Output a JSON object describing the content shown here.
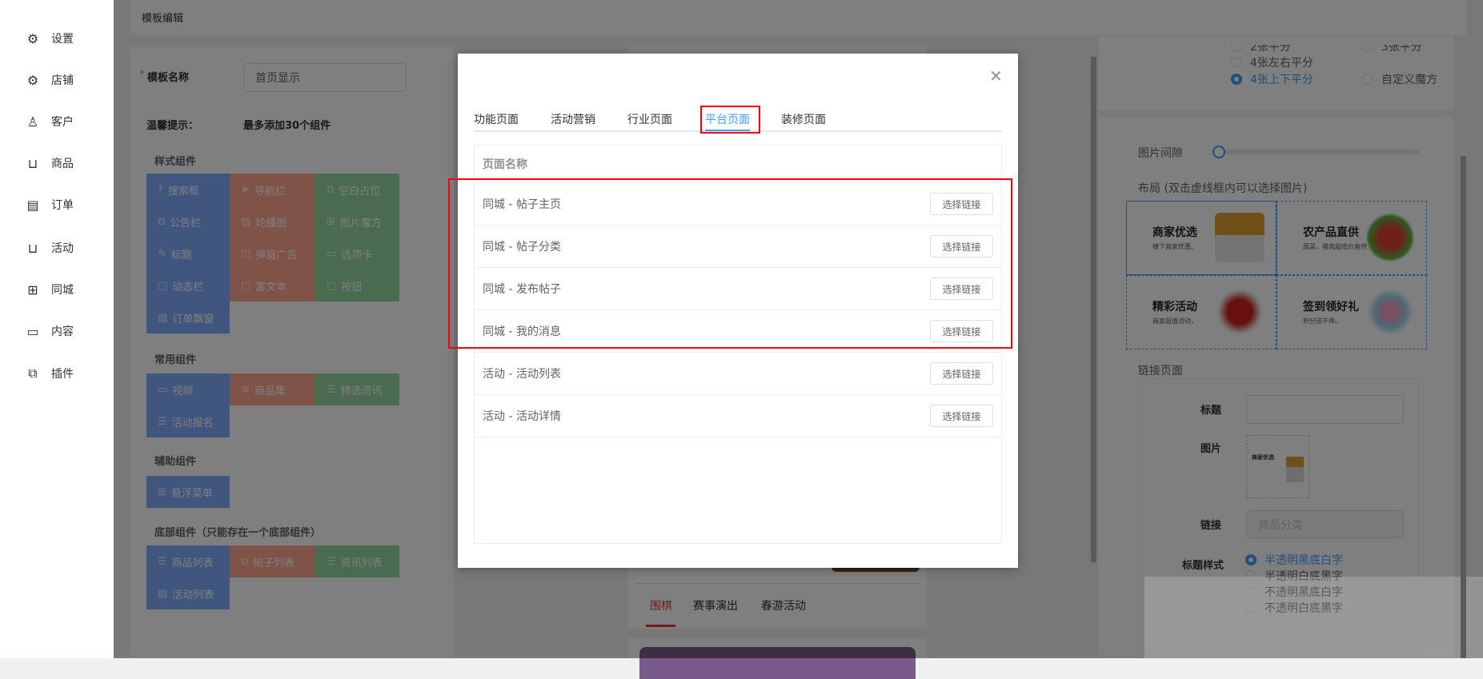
{
  "sidebar": {
    "items": [
      {
        "label": "设置",
        "icon": "gear-icon",
        "glyph": "⚙"
      },
      {
        "label": "店铺",
        "icon": "shop-gear-icon",
        "glyph": "⚙"
      },
      {
        "label": "客户",
        "icon": "user-icon",
        "glyph": "♙"
      },
      {
        "label": "商品",
        "icon": "bag-icon",
        "glyph": "⊔"
      },
      {
        "label": "订单",
        "icon": "calendar-icon",
        "glyph": "▤"
      },
      {
        "label": "活动",
        "icon": "bag-icon",
        "glyph": "⊔"
      },
      {
        "label": "同城",
        "icon": "grid-icon",
        "glyph": "⊞"
      },
      {
        "label": "内容",
        "icon": "article-icon",
        "glyph": "▭"
      },
      {
        "label": "插件",
        "icon": "puzzle-icon",
        "glyph": "⧉"
      }
    ]
  },
  "header": {
    "title": "模板编辑"
  },
  "left": {
    "name_label": "模板名称",
    "name_required": "*",
    "name_value": "首页显示",
    "tip_label": "温馨提示：",
    "tip_value": "最多添加30个组件",
    "groups": [
      {
        "title": "样式组件",
        "items": [
          {
            "label": "搜索框",
            "color": "blue",
            "glyph": "?"
          },
          {
            "label": "导航栏",
            "color": "red",
            "glyph": "➤"
          },
          {
            "label": "空白占位",
            "color": "green",
            "glyph": "⧉"
          },
          {
            "label": "公告栏",
            "color": "blue",
            "glyph": "⧉"
          },
          {
            "label": "轮播图",
            "color": "red",
            "glyph": "▨"
          },
          {
            "label": "图片魔方",
            "color": "green",
            "glyph": "⊞"
          },
          {
            "label": "标题",
            "color": "blue",
            "glyph": "✎"
          },
          {
            "label": "弹窗广告",
            "color": "red",
            "glyph": "◫"
          },
          {
            "label": "选项卡",
            "color": "green",
            "glyph": "▭"
          },
          {
            "label": "动态栏",
            "color": "blue",
            "glyph": "▢"
          },
          {
            "label": "富文本",
            "color": "red",
            "glyph": "▢"
          },
          {
            "label": "按钮",
            "color": "green",
            "glyph": "▢"
          },
          {
            "label": "订单飘窗",
            "color": "blue",
            "glyph": "▨"
          }
        ]
      },
      {
        "title": "常用组件",
        "items": [
          {
            "label": "视频",
            "color": "blue",
            "glyph": "▭"
          },
          {
            "label": "商品集",
            "color": "red",
            "glyph": "≋"
          },
          {
            "label": "精选资讯",
            "color": "green",
            "glyph": "☰"
          },
          {
            "label": "活动报名",
            "color": "blue",
            "glyph": "☰"
          }
        ]
      },
      {
        "title": "辅助组件",
        "items": [
          {
            "label": "悬浮菜单",
            "color": "blue",
            "glyph": "⊞"
          }
        ]
      },
      {
        "title": "底部组件（只能存在一个底部组件）",
        "items": [
          {
            "label": "商品列表",
            "color": "blue",
            "glyph": "☰"
          },
          {
            "label": "帖子列表",
            "color": "red",
            "glyph": "⧉"
          },
          {
            "label": "资讯列表",
            "color": "green",
            "glyph": "☰"
          },
          {
            "label": "活动列表",
            "color": "blue",
            "glyph": "▤"
          }
        ]
      }
    ]
  },
  "preview": {
    "tabs": [
      "围棋",
      "赛事演出",
      "春游活动"
    ],
    "active_tab": 0
  },
  "right": {
    "layout_options": [
      {
        "label": "2张平分"
      },
      {
        "label": "3张平分"
      },
      {
        "label": "4张左右平分"
      },
      {
        "label": "4张上下平分",
        "checked": true
      },
      {
        "label": "自定义魔方"
      }
    ],
    "gap_label": "图片间隙",
    "gap_value": 0,
    "layout_label": "布局 (双击虚线框内可以选择图片)",
    "cells": [
      {
        "title": "商家优选",
        "sub": "楼下商家优惠。"
      },
      {
        "title": "农产品直供",
        "sub": "蔬菜，猪肉超低价直供"
      },
      {
        "title": "精彩活动",
        "sub": "商家超值活动，"
      },
      {
        "title": "签到领好礼",
        "sub": "积分送不停。"
      }
    ],
    "link_section": "链接页面",
    "title_label": "标题",
    "title_value": "",
    "image_label": "图片",
    "image_caption": "商家优选",
    "link_label": "链接",
    "link_placeholder": "商品分类",
    "style_label": "标题样式",
    "styles": [
      {
        "label": "半透明黑底白字",
        "checked": true
      },
      {
        "label": "半透明白底黑字"
      },
      {
        "label": "不透明黑底白字"
      },
      {
        "label": "不透明白底黑字"
      }
    ]
  },
  "modal": {
    "tabs": [
      "功能页面",
      "活动营销",
      "行业页面",
      "平台页面",
      "装修页面"
    ],
    "active_tab": 3,
    "column": "页面名称",
    "rows": [
      "同城 - 帖子主页",
      "同城 - 帖子分类",
      "同城 - 发布帖子",
      "同城 - 我的消息",
      "活动 - 活动列表",
      "活动 - 活动详情"
    ],
    "button": "选择链接",
    "close_icon": "close-icon"
  },
  "colors": {
    "accent": "#409eff",
    "highlight": "#ff0000",
    "preview_tab": "#e33b3b"
  }
}
